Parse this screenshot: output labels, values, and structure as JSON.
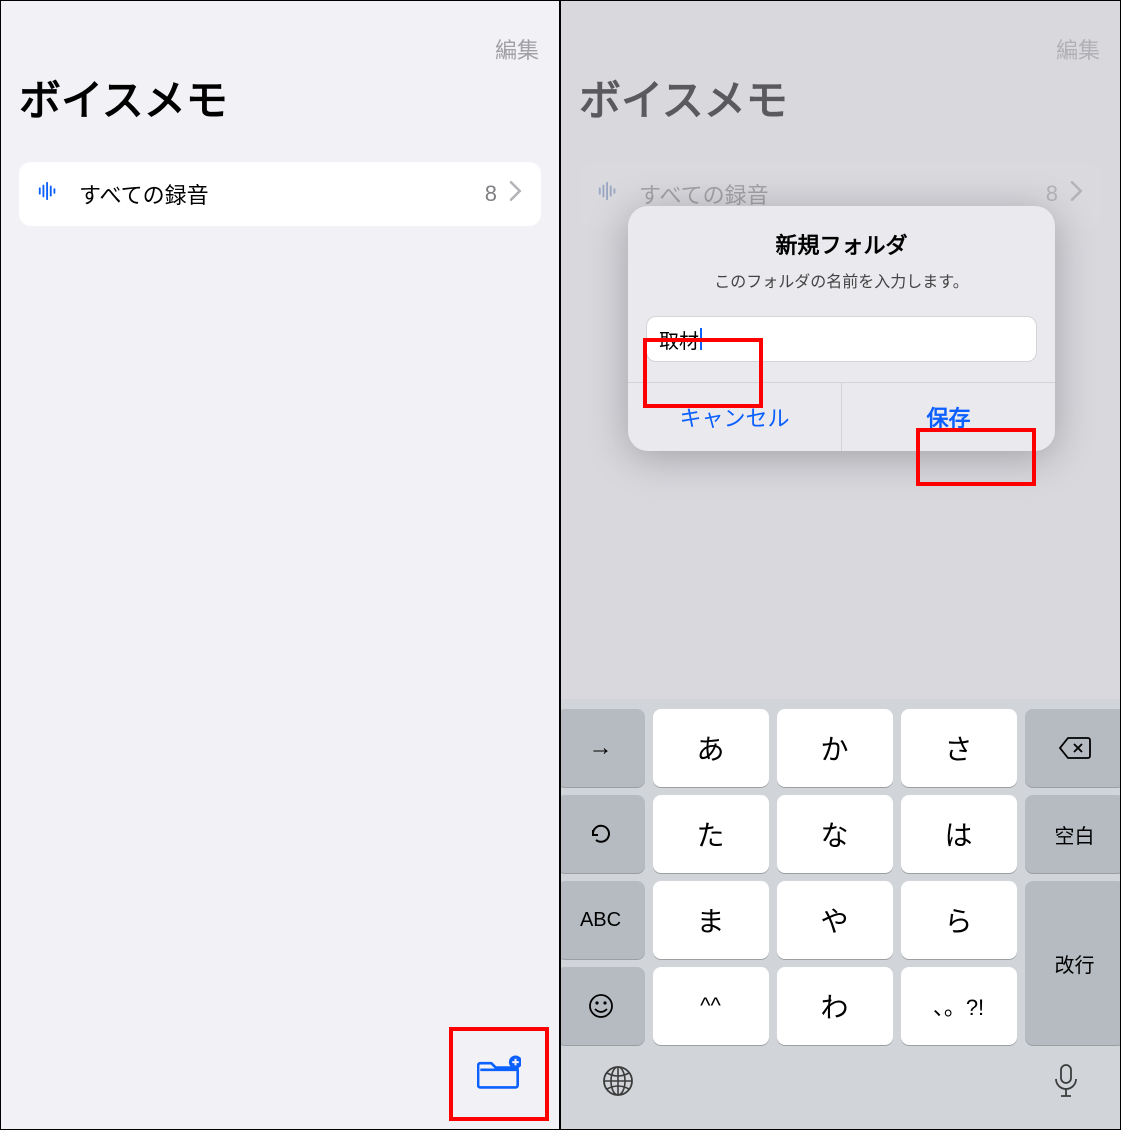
{
  "left": {
    "edit": "編集",
    "title": "ボイスメモ",
    "row": {
      "label": "すべての録音",
      "count": "8"
    }
  },
  "right": {
    "edit": "編集",
    "title": "ボイスメモ",
    "row": {
      "label": "すべての録音",
      "count": "8"
    },
    "dialog": {
      "title": "新規フォルダ",
      "subtitle": "このフォルダの名前を入力します。",
      "value": "取材",
      "cancel": "キャンセル",
      "save": "保存"
    },
    "keyboard": {
      "rows": [
        [
          "→",
          "あ",
          "か",
          "さ",
          "⌫"
        ],
        [
          "↺",
          "た",
          "な",
          "は",
          "空白"
        ],
        [
          "ABC",
          "ま",
          "や",
          "ら",
          "改行"
        ],
        [
          "☺",
          "^^",
          "わ",
          "、。?!",
          ""
        ]
      ],
      "globe": "🌐",
      "mic": "🎤"
    }
  }
}
